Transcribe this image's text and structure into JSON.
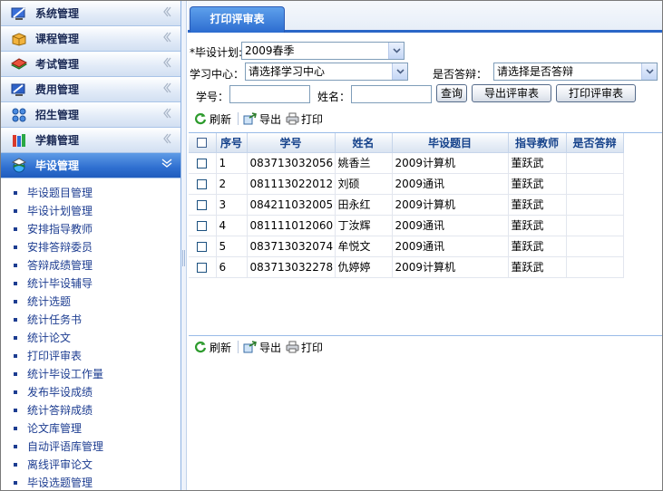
{
  "sidebar": {
    "menus": [
      {
        "label": "系统管理",
        "icon": "system-settings-icon"
      },
      {
        "label": "课程管理",
        "icon": "course-box-icon"
      },
      {
        "label": "考试管理",
        "icon": "exam-books-icon"
      },
      {
        "label": "费用管理",
        "icon": "fee-monitor-icon"
      },
      {
        "label": "招生管理",
        "icon": "enrollment-network-icon"
      },
      {
        "label": "学籍管理",
        "icon": "student-record-books-icon"
      }
    ],
    "active_menu": {
      "label": "毕设管理",
      "icon": "graduation-globe-icon"
    },
    "submenu": [
      "毕设题目管理",
      "毕设计划管理",
      "安排指导教师",
      "安排答辩委员",
      "答辩成绩管理",
      "统计毕设辅导",
      "统计选题",
      "统计任务书",
      "统计论文",
      "打印评审表",
      "统计毕设工作量",
      "发布毕设成绩",
      "统计答辩成绩",
      "论文库管理",
      "自动评语库管理",
      "离线评审论文",
      "毕设选题管理"
    ]
  },
  "tab": {
    "label": "打印评审表"
  },
  "form": {
    "plan_label": "*毕设计划:",
    "plan_value": "2009春季",
    "center_label": "学习中心：",
    "center_value": "请选择学习中心",
    "defense_label": "是否答辩：",
    "defense_value": "请选择是否答辩",
    "student_no_label": "学号：",
    "name_label": "姓名：",
    "query_button": "查询",
    "export_button": "导出评审表",
    "print_button": "打印评审表"
  },
  "toolbar": {
    "refresh": "刷新",
    "export": "导出",
    "print": "打印"
  },
  "table": {
    "columns": [
      "序号",
      "学号",
      "姓名",
      "毕设题目",
      "指导教师",
      "是否答辩"
    ],
    "rows": [
      [
        "1",
        "083713032056",
        "姚香兰",
        "2009计算机",
        "董跃武",
        ""
      ],
      [
        "2",
        "081113022012",
        "刘硕",
        "2009通讯",
        "董跃武",
        ""
      ],
      [
        "3",
        "084211032005",
        "田永红",
        "2009计算机",
        "董跃武",
        ""
      ],
      [
        "4",
        "081111012060",
        "丁汝辉",
        "2009通讯",
        "董跃武",
        ""
      ],
      [
        "5",
        "083713032074",
        "牟悦文",
        "2009通讯",
        "董跃武",
        ""
      ],
      [
        "6",
        "083713032278",
        "仇婷婷",
        "2009计算机",
        "董跃武",
        ""
      ]
    ]
  },
  "colors": {
    "accent": "#2c6cd0",
    "header_text": "#15428b",
    "link_text": "#1d3d91"
  }
}
